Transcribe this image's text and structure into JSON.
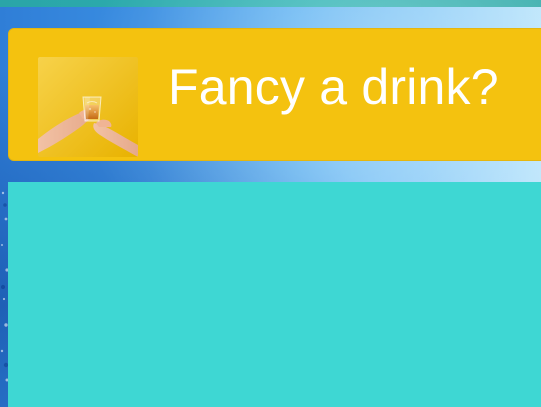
{
  "header": {
    "title": "Fancy a drink?"
  },
  "tile": {
    "image_icon": "toast-glass-hands-image"
  },
  "colors": {
    "tile_background": "#F4C20F",
    "content_background": "#3ED7D3",
    "top_strip": "#2AA7A5",
    "title_text": "#FFFFFF",
    "background_blue": "#2F7ED7",
    "background_light_blue": "#B9E4FB"
  }
}
